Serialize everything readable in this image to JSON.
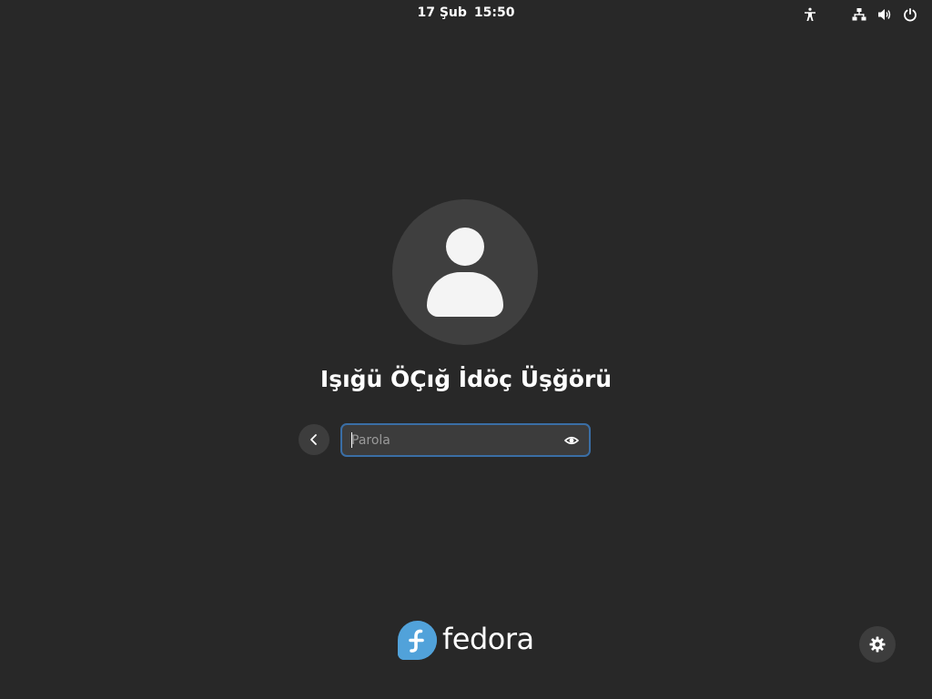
{
  "top_bar": {
    "date": "17 Şub",
    "time": "15:50",
    "icons": [
      "accessibility-icon",
      "network-icon",
      "volume-icon",
      "power-icon"
    ]
  },
  "login": {
    "user_name": "Işığü ÖÇığ İdöç Üşğörü",
    "password_placeholder": "Parola",
    "password_value": ""
  },
  "branding": {
    "wordmark": "fedora",
    "logo_color": "#51a2da"
  },
  "colors": {
    "background": "#282828",
    "focus_border": "#3a6ea5"
  }
}
